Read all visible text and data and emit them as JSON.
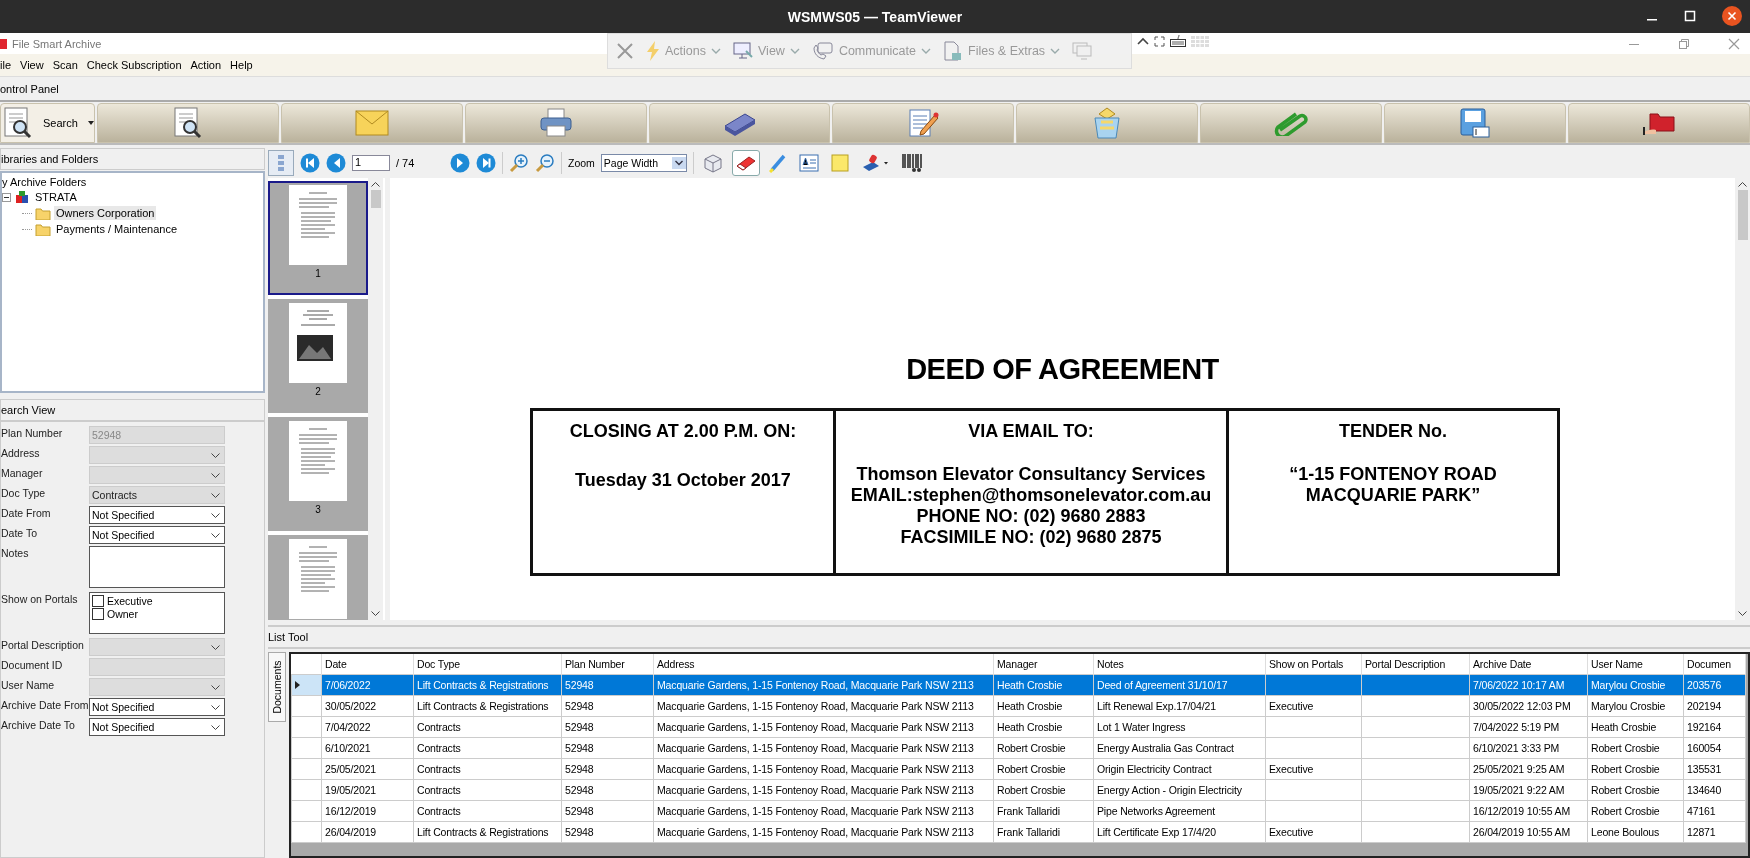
{
  "os_title": "WSMWS05 — TeamViewer",
  "app_title": "File Smart Archive",
  "remote_toolbar": [
    {
      "kind": "close"
    },
    {
      "kind": "menu",
      "label": "Actions"
    },
    {
      "kind": "menu",
      "label": "View"
    },
    {
      "kind": "menu",
      "label": "Communicate"
    },
    {
      "kind": "menu",
      "label": "Files & Extras"
    },
    {
      "kind": "monitor"
    }
  ],
  "menu": [
    "ile",
    "View",
    "Scan",
    "Check Subscription",
    "Action",
    "Help"
  ],
  "control_panel_title": "ontrol Panel",
  "search_button_label": "Search",
  "libraries": {
    "title": "ibraries and Folders",
    "root_label": "y Archive Folders",
    "tree": [
      {
        "label": "STRATA",
        "expanded": true,
        "selected": false,
        "children": [
          {
            "label": "Owners Corporation",
            "selected": true
          },
          {
            "label": "Payments / Maintenance",
            "selected": false
          }
        ]
      }
    ]
  },
  "search_view": {
    "title": "earch View",
    "fields": [
      {
        "label": "Plan Number",
        "kind": "text",
        "value": "52948",
        "disabled": true
      },
      {
        "label": "Address",
        "kind": "dropdown",
        "disabled": true
      },
      {
        "label": "Manager",
        "kind": "dropdown",
        "disabled": true
      },
      {
        "label": "Doc Type",
        "kind": "dropdown",
        "value": "Contracts",
        "disabled": true
      },
      {
        "label": "Date From",
        "kind": "dropdown",
        "value": "Not Specified",
        "disabled": false
      },
      {
        "label": "Date To",
        "kind": "dropdown",
        "value": "Not Specified",
        "disabled": false
      },
      {
        "label": "Notes",
        "kind": "textarea",
        "disabled": false
      },
      {
        "label": "Show on Portals",
        "kind": "checklist",
        "options": [
          {
            "label": "Executive",
            "checked": false
          },
          {
            "label": "Owner",
            "checked": false
          }
        ]
      },
      {
        "label": "Portal Description",
        "kind": "dropdown",
        "disabled": true
      },
      {
        "label": "Document ID",
        "kind": "text",
        "disabled": true
      },
      {
        "label": "User Name",
        "kind": "dropdown",
        "disabled": true
      },
      {
        "label": "Archive Date From",
        "kind": "dropdown",
        "value": "Not Specified",
        "disabled": false
      },
      {
        "label": "Archive Date To",
        "kind": "dropdown",
        "value": "Not Specified",
        "disabled": false
      }
    ]
  },
  "viewer": {
    "page": "1",
    "page_count": "/ 74",
    "zoom_label": "Zoom",
    "zoom_value": "Page Width",
    "tools": [
      {
        "kind": "box",
        "selected": false
      },
      {
        "kind": "eraser",
        "selected": true
      },
      {
        "kind": "highlighter",
        "selected": false
      },
      {
        "kind": "textbox",
        "selected": false
      },
      {
        "kind": "note",
        "selected": false
      },
      {
        "kind": "stamp",
        "selected": false
      },
      {
        "kind": "barcode",
        "selected": false
      }
    ],
    "thumbnails": [
      {
        "label": "1",
        "kind": "text",
        "selected": true
      },
      {
        "label": "2",
        "kind": "photo",
        "selected": false
      },
      {
        "label": "3",
        "kind": "text",
        "selected": false
      },
      {
        "kind": "text",
        "selected": false
      }
    ],
    "document": {
      "title": "DEED OF AGREEMENT",
      "cells": [
        {
          "heading": "CLOSING AT 2.00 P.M. ON:",
          "lines": [
            "Tuesday 31 October 2017"
          ]
        },
        {
          "heading": "VIA EMAIL TO:",
          "lines": [
            "Thomson Elevator Consultancy Services",
            "EMAIL:stephen@thomsonelevator.com.au",
            "PHONE NO: (02) 9680 2883",
            "FACSIMILE NO: (02) 9680 2875"
          ]
        },
        {
          "heading": "TENDER No.",
          "lines": [
            "“1-15 FONTENOY ROAD",
            "MACQUARIE PARK”"
          ]
        }
      ]
    }
  },
  "list_tool": {
    "title": "List Tool",
    "side_tab": "Documents",
    "columns": [
      "Date",
      "Doc Type",
      "Plan Number",
      "Address",
      "Manager",
      "Notes",
      "Show on Portals",
      "Portal Description",
      "Archive Date",
      "User Name",
      "Documen"
    ],
    "rows": [
      {
        "selected": true,
        "cells": [
          "7/06/2022",
          "Lift Contracts & Registrations",
          "52948",
          "Macquarie Gardens, 1-15 Fontenoy Road, Macquarie Park  NSW  2113",
          "Heath Crosbie",
          "Deed of Agreement 31/10/17",
          null,
          null,
          "7/06/2022 10:17 AM",
          "Marylou Crosbie",
          "203576"
        ]
      },
      {
        "selected": false,
        "cells": [
          "30/05/2022",
          "Lift Contracts & Registrations",
          "52948",
          "Macquarie Gardens, 1-15 Fontenoy Road, Macquarie Park  NSW  2113",
          "Heath Crosbie",
          "Lift Renewal Exp.17/04/21",
          "Executive",
          null,
          "30/05/2022 12:03 PM",
          "Marylou Crosbie",
          "202194"
        ]
      },
      {
        "selected": false,
        "cells": [
          "7/04/2022",
          "Contracts",
          "52948",
          "Macquarie Gardens, 1-15 Fontenoy Road, Macquarie Park  NSW  2113",
          "Heath Crosbie",
          "Lot 1 Water Ingress",
          null,
          null,
          "7/04/2022 5:19 PM",
          "Heath Crosbie",
          "192164"
        ]
      },
      {
        "selected": false,
        "cells": [
          "6/10/2021",
          "Contracts",
          "52948",
          "Macquarie Gardens, 1-15 Fontenoy Road, Macquarie Park  NSW  2113",
          "Robert Crosbie",
          "Energy Australia Gas Contract",
          null,
          null,
          "6/10/2021 3:33 PM",
          "Robert Crosbie",
          "160054"
        ]
      },
      {
        "selected": false,
        "cells": [
          "25/05/2021",
          "Contracts",
          "52948",
          "Macquarie Gardens, 1-15 Fontenoy Road, Macquarie Park  NSW  2113",
          "Robert Crosbie",
          "Origin Electricity Contract",
          "Executive",
          null,
          "25/05/2021 9:25 AM",
          "Robert Crosbie",
          "135531"
        ]
      },
      {
        "selected": false,
        "cells": [
          "19/05/2021",
          "Contracts",
          "52948",
          "Macquarie Gardens, 1-15 Fontenoy Road, Macquarie Park  NSW  2113",
          "Robert Crosbie",
          "Energy Action - Origin Electricity",
          null,
          null,
          "19/05/2021 9:22 AM",
          "Robert Crosbie",
          "134640"
        ]
      },
      {
        "selected": false,
        "cells": [
          "16/12/2019",
          "Contracts",
          "52948",
          "Macquarie Gardens, 1-15 Fontenoy Road, Macquarie Park  NSW  2113",
          "Frank Tallaridi",
          "Pipe Networks Agreement",
          null,
          null,
          "16/12/2019 10:55 AM",
          "Robert Crosbie",
          "47161"
        ]
      },
      {
        "selected": false,
        "cells": [
          "26/04/2019",
          "Lift Contracts & Registrations",
          "52948",
          "Macquarie Gardens, 1-15 Fontenoy Road, Macquarie Park  NSW  2113",
          "Frank Tallaridi",
          "Lift Certificate Exp 17/4/20",
          "Executive",
          null,
          "26/04/2019 10:55 AM",
          "Leone Boulous",
          "12871"
        ]
      }
    ]
  }
}
